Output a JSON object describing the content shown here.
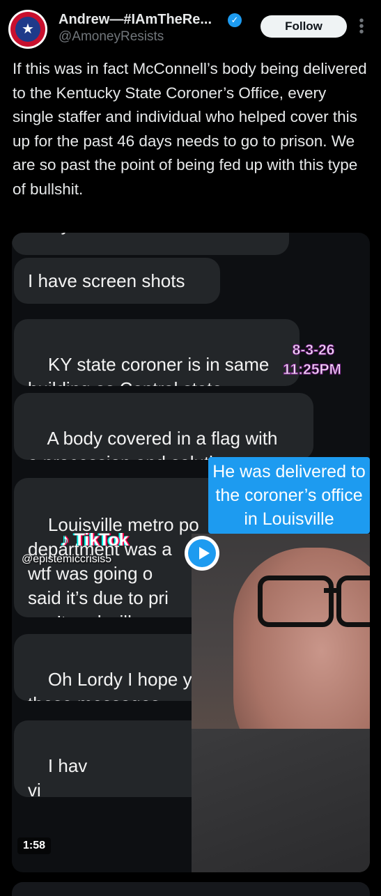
{
  "author": {
    "display_name": "Andrew—#IAmTheRe...",
    "handle": "@AmoneyResists",
    "verified": true,
    "follow_label": "Follow"
  },
  "tweet": {
    "text": "If this was in fact McConnell’s body being delivered to the Kentucky State Coroner’s Office, every single staffer and individual who helped cover this up for the past 46 days needs to go to prison. We are so past the point of being fed up with this type of bullshit."
  },
  "video": {
    "messages": [
      "today",
      "I have screen shots",
      "KY state coroner is in same\nbuilding as Central state",
      "A body covered in a flag with\na procession and saluting",
      "Louisville metro po\ndepartment was a\nwtf was going o\nsaid it’s due to pri\ncan’t and will say",
      "Oh Lordy I hope y\nthese messages",
      "I hav\nvi"
    ],
    "stamp_date": "8-3-26",
    "stamp_time": "11:25PM",
    "caption": "He was delivered to the coroner’s office in Louisville",
    "watermark": "TikTok",
    "watermark_user": "@epistemiccrisis5",
    "duration": "1:58"
  },
  "colors": {
    "background": "#000000",
    "text": "#e7e9ea",
    "secondary": "#71767b",
    "accent": "#1d9bf0",
    "bubble": "#232629"
  },
  "icons": [
    "verified-badge-icon",
    "more-options-icon",
    "play-icon",
    "tiktok-logo-icon"
  ]
}
